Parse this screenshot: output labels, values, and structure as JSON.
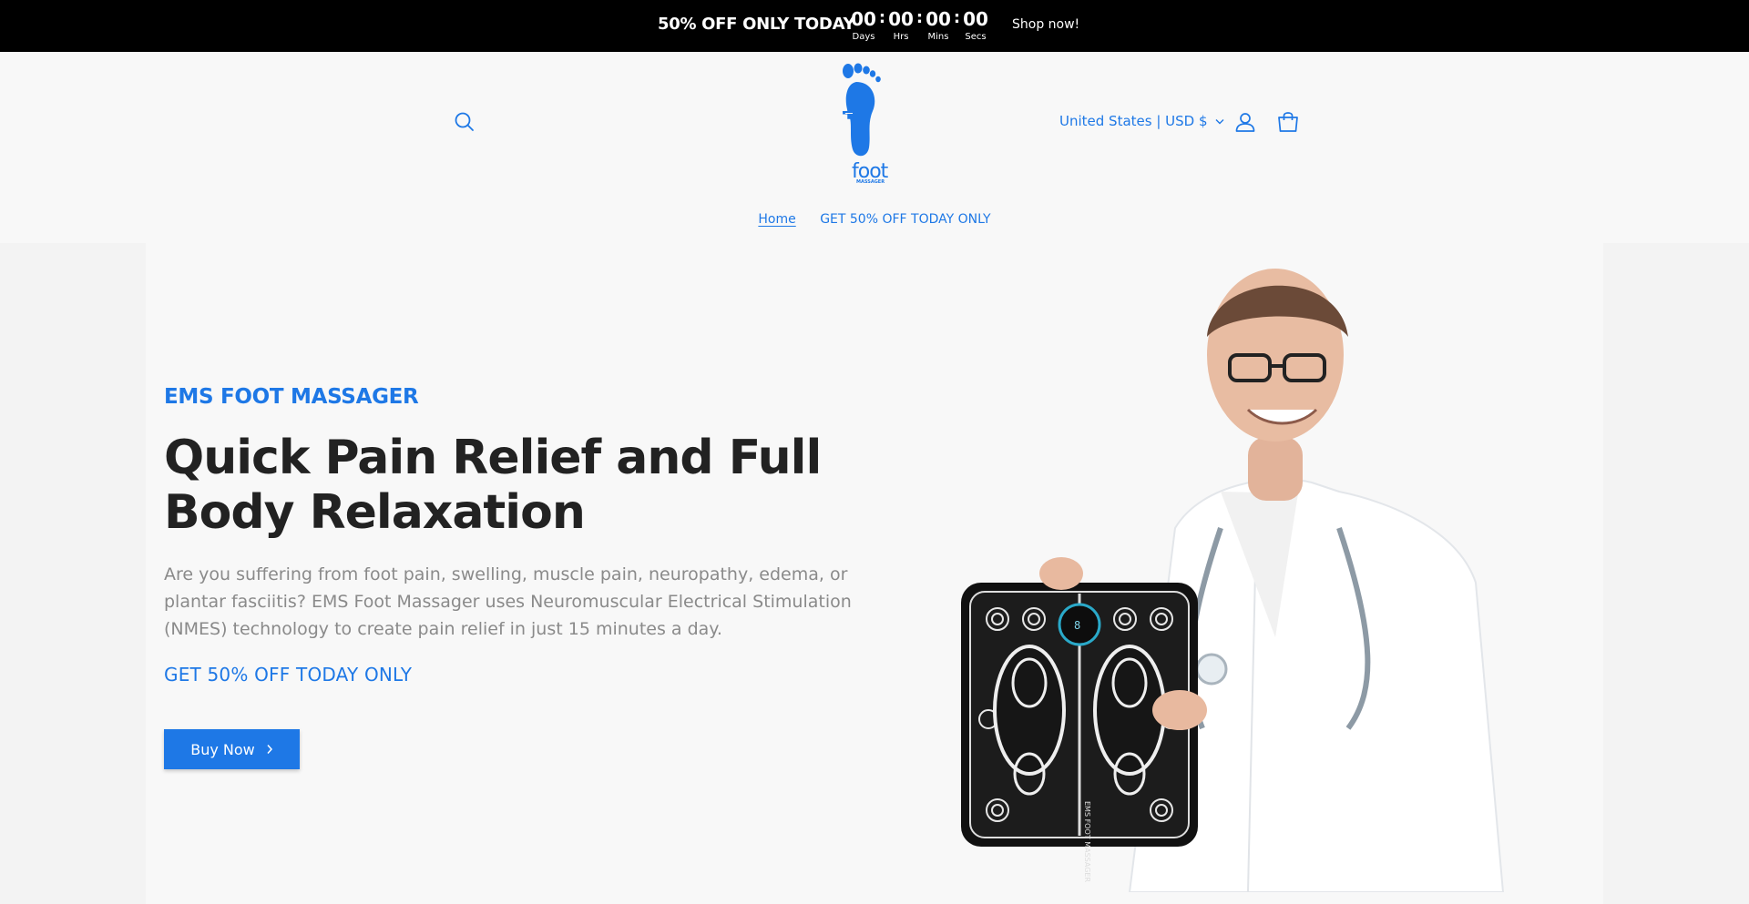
{
  "announcement": {
    "promo": "50% OFF ONLY TODAY",
    "timer": [
      {
        "value": "00",
        "label": "Days"
      },
      {
        "value": "00",
        "label": "Hrs"
      },
      {
        "value": "00",
        "label": "Mins"
      },
      {
        "value": "00",
        "label": "Secs"
      }
    ],
    "separator": ":",
    "shop_link": "Shop now!"
  },
  "header": {
    "logo_text": "foot",
    "logo_subtext": "MASSAGER",
    "country_selector": "United States | USD $",
    "icons": [
      "search-icon",
      "account-icon",
      "cart-icon"
    ]
  },
  "nav": {
    "items": [
      {
        "label": "Home"
      },
      {
        "label": "GET 50% OFF TODAY ONLY"
      }
    ]
  },
  "hero": {
    "eyebrow": "EMS FOOT MASSAGER",
    "headline": "Quick Pain Relief and Full Body Relaxation",
    "description": "Are you suffering from foot pain, swelling, muscle pain, neuropathy, edema, or plantar fasciitis? EMS Foot Massager uses Neuromuscular Electrical Stimulation (NMES) technology to create pain relief in just 15 minutes a day.",
    "offer": "GET 50% OFF TODAY ONLY",
    "button_label": "Buy Now",
    "product_text": "EMS FOOT MASSAGER"
  },
  "colors": {
    "accent": "#1e78e6",
    "topbar": "#000000",
    "headline": "#222222",
    "body_text": "#8a8a8a"
  }
}
